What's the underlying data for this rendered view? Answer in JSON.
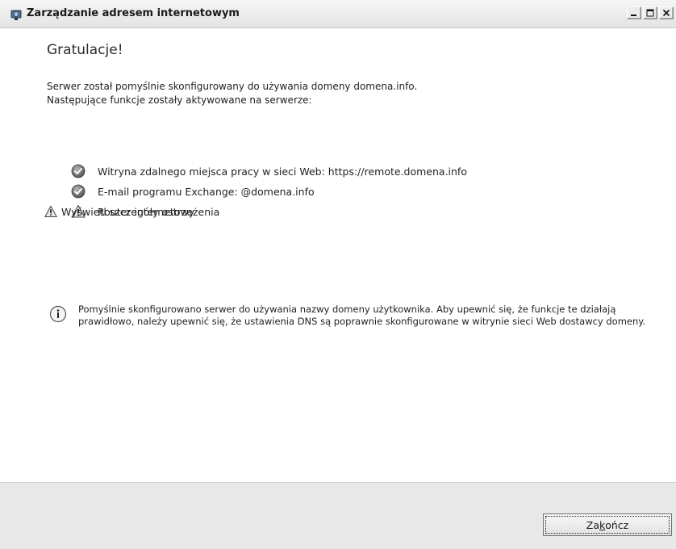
{
  "window": {
    "title": "Zarządzanie adresem internetowym",
    "app_icon": "network-globe-icon",
    "controls": [
      "minimize-icon",
      "maximize-icon",
      "close-icon"
    ]
  },
  "main": {
    "heading": "Gratulacje!",
    "description_lines": [
      "Serwer został pomyślnie skonfigurowany do używania domeny domena.info.",
      "Następujące funkcje zostały aktywowane na serwerze:"
    ],
    "features": [
      {
        "status": "success",
        "icon": "check-circle-icon",
        "label": "Witryna zdalnego miejsca pracy w sieci Web: https://remote.domena.info"
      },
      {
        "status": "success",
        "icon": "check-circle-icon",
        "label": "E-mail programu Exchange: @domena.info"
      },
      {
        "status": "warning",
        "icon": "warning-triangle-icon",
        "label": "Router internetowy"
      }
    ],
    "warning_link": "Wyświetl szczegóły ostrzeżenia",
    "info_message": "Pomyślnie skonfigurowano serwer do używania nazwy domeny użytkownika. Aby upewnić się, że funkcje te działają prawidłowo, należy upewnić się, że ustawienia DNS są poprawnie skonfigurowane w witrynie sieci Web dostawcy domeny."
  },
  "footer": {
    "finish_label_before": "Za",
    "finish_label_accel": "k",
    "finish_label_after": "ończ"
  },
  "colors": {
    "footer_bg": "#e8e8e8",
    "check_gray": "#6f6f6f",
    "warning_yellow": "#f2d23c"
  }
}
